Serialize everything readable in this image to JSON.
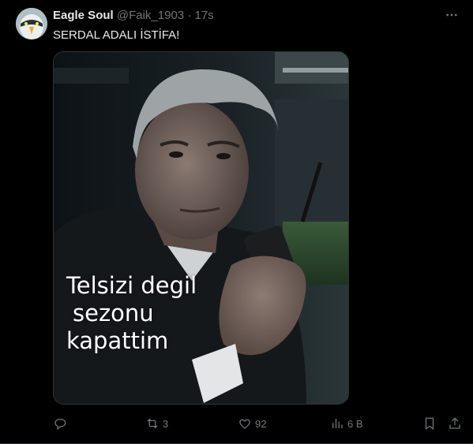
{
  "tweet": {
    "author_name": "Eagle Soul",
    "handle": "@Faik_1903",
    "separator": "·",
    "time": "17s",
    "text": "SERDAL ADALI İSTİFA!",
    "more_icon": "more-horizontal-icon",
    "avatar_icon": "eagle-avatar"
  },
  "media": {
    "caption_lines": [
      "Telsizi degil",
      "sezonu",
      "kapattim"
    ],
    "description_icon": "photo"
  },
  "actions": {
    "reply": {
      "icon": "reply-icon",
      "count": ""
    },
    "retweet": {
      "icon": "retweet-icon",
      "count": "3"
    },
    "like": {
      "icon": "heart-icon",
      "count": "92"
    },
    "views": {
      "icon": "views-icon",
      "count": "6 B"
    },
    "bookmark": {
      "icon": "bookmark-icon"
    },
    "share": {
      "icon": "share-icon"
    }
  },
  "colors": {
    "background": "#000000",
    "text_primary": "#e7e9ea",
    "text_secondary": "#71767b",
    "border": "#2f3336"
  }
}
